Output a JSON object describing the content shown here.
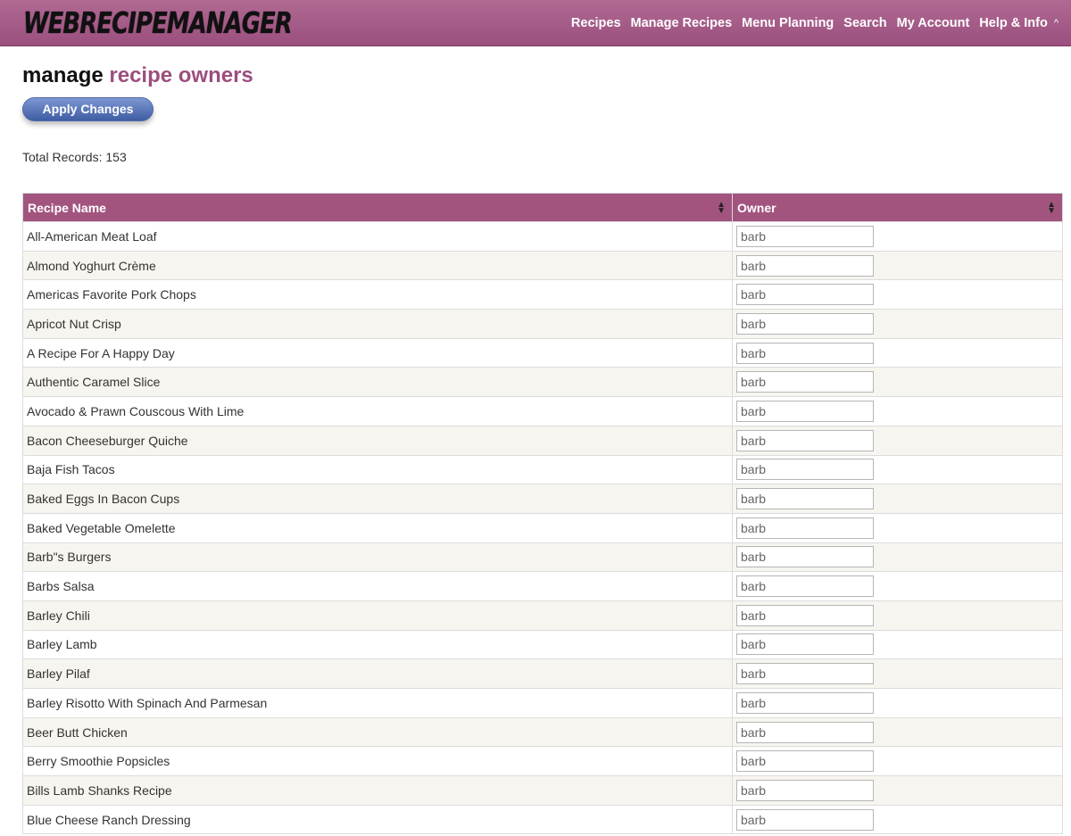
{
  "header": {
    "logo": "WEBRECIPEMANAGER",
    "nav": [
      "Recipes",
      "Manage Recipes",
      "Menu Planning",
      "Search",
      "My Account",
      "Help & Info"
    ],
    "caret": "^"
  },
  "page": {
    "title_main": "manage",
    "title_accent": "recipe owners",
    "apply_label": "Apply Changes",
    "total_label": "Total Records: 153"
  },
  "table": {
    "headers": [
      "Recipe Name",
      "Owner"
    ],
    "rows": [
      {
        "name": "All-American Meat Loaf",
        "owner": "barb"
      },
      {
        "name": "Almond Yoghurt Crème",
        "owner": "barb"
      },
      {
        "name": "Americas Favorite Pork Chops",
        "owner": "barb"
      },
      {
        "name": "Apricot Nut Crisp",
        "owner": "barb"
      },
      {
        "name": "A Recipe For A Happy Day",
        "owner": "barb"
      },
      {
        "name": "Authentic Caramel Slice",
        "owner": "barb"
      },
      {
        "name": "Avocado & Prawn Couscous With Lime",
        "owner": "barb"
      },
      {
        "name": "Bacon Cheeseburger Quiche",
        "owner": "barb"
      },
      {
        "name": "Baja Fish Tacos",
        "owner": "barb"
      },
      {
        "name": "Baked Eggs In Bacon Cups",
        "owner": "barb"
      },
      {
        "name": "Baked Vegetable Omelette",
        "owner": "barb"
      },
      {
        "name": "Barb\"s Burgers",
        "owner": "barb"
      },
      {
        "name": "Barbs Salsa",
        "owner": "barb"
      },
      {
        "name": "Barley Chili",
        "owner": "barb"
      },
      {
        "name": "Barley Lamb",
        "owner": "barb"
      },
      {
        "name": "Barley Pilaf",
        "owner": "barb"
      },
      {
        "name": "Barley Risotto With Spinach And Parmesan",
        "owner": "barb"
      },
      {
        "name": "Beer Butt Chicken",
        "owner": "barb"
      },
      {
        "name": "Berry Smoothie Popsicles",
        "owner": "barb"
      },
      {
        "name": "Bills Lamb Shanks Recipe",
        "owner": "barb"
      },
      {
        "name": "Blue Cheese Ranch Dressing",
        "owner": "barb"
      }
    ]
  }
}
